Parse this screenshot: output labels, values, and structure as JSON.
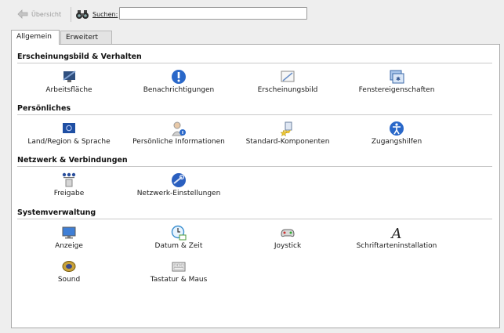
{
  "toolbar": {
    "back_label": "Übersicht",
    "search_label": "Suchen:",
    "search_value": ""
  },
  "tabs": [
    {
      "label": "Allgemein",
      "active": true
    },
    {
      "label": "Erweitert",
      "active": false
    }
  ],
  "sections": {
    "appearance": {
      "title": "Erscheinungsbild & Verhalten",
      "items": [
        "Arbeitsfläche",
        "Benachrichtigungen",
        "Erscheinungsbild",
        "Fenstereigenschaften"
      ]
    },
    "personal": {
      "title": "Persönliches",
      "items": [
        "Land/Region & Sprache",
        "Persönliche Informationen",
        "Standard-Komponenten",
        "Zugangshilfen"
      ]
    },
    "network": {
      "title": "Netzwerk & Verbindungen",
      "items": [
        "Freigabe",
        "Netzwerk-Einstellungen"
      ]
    },
    "system": {
      "title": "Systemverwaltung",
      "items": [
        "Anzeige",
        "Datum & Zeit",
        "Joystick",
        "Schriftarteninstallation",
        "Sound",
        "Tastatur & Maus"
      ]
    }
  },
  "icons": {
    "back": "arrow-left-icon",
    "search": "binoculars-icon"
  }
}
